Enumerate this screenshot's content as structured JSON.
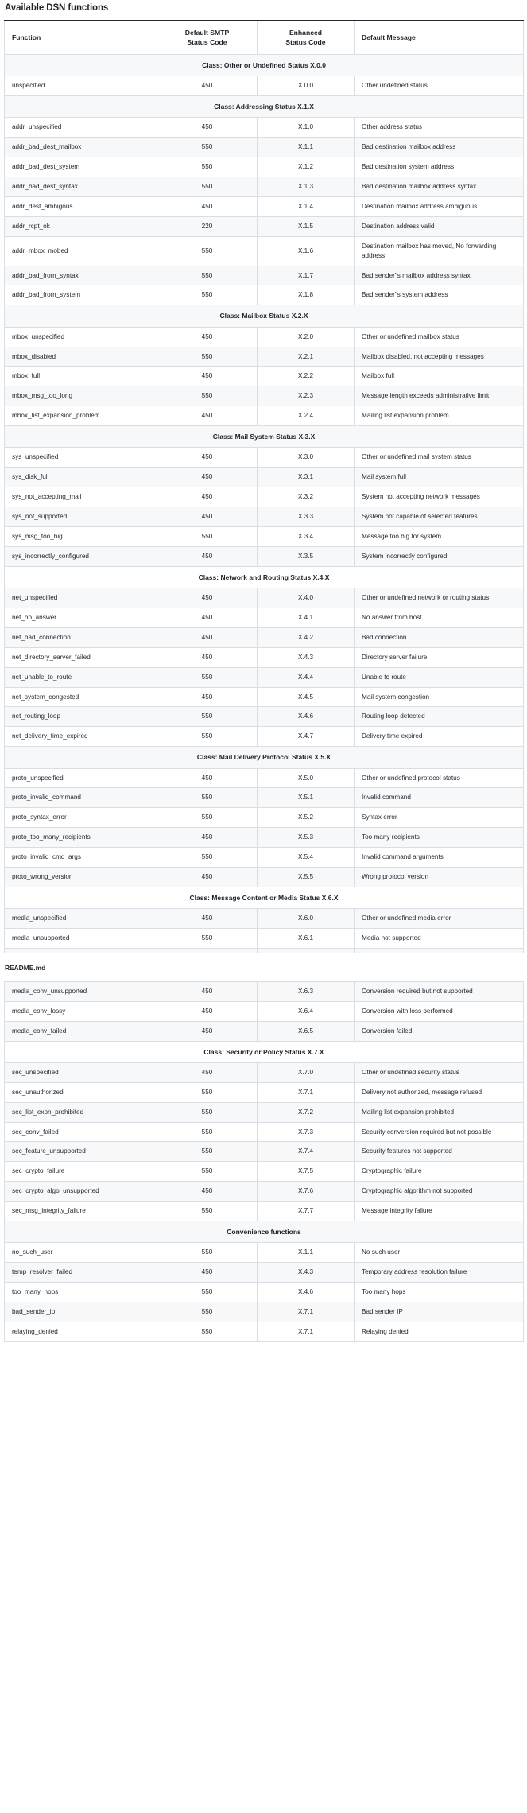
{
  "document": {
    "title": "Available DSN functions",
    "page_break_label": "README.md"
  },
  "table": {
    "columns": [
      {
        "label": "Function",
        "align": "left"
      },
      {
        "label": "Default SMTP Status Code",
        "line1": "Default SMTP",
        "line2": "Status Code",
        "align": "center"
      },
      {
        "label": "Enhanced Status Code",
        "line1": "Enhanced",
        "line2": "Status Code",
        "align": "center"
      },
      {
        "label": "Default Message",
        "align": "left"
      }
    ],
    "sections": [
      {
        "class_header": "Class: Other or Undefined Status X.0.0",
        "rows": [
          {
            "function": "unspecified",
            "smtp": "450",
            "enhanced": "X.0.0",
            "message": "Other undefined status"
          }
        ]
      },
      {
        "class_header": "Class: Addressing Status X.1.X",
        "rows": [
          {
            "function": "addr_unspecified",
            "smtp": "450",
            "enhanced": "X.1.0",
            "message": "Other address status"
          },
          {
            "function": "addr_bad_dest_mailbox",
            "smtp": "550",
            "enhanced": "X.1.1",
            "message": "Bad destination mailbox address"
          },
          {
            "function": "addr_bad_dest_system",
            "smtp": "550",
            "enhanced": "X.1.2",
            "message": "Bad destination system address"
          },
          {
            "function": "addr_bad_dest_syntax",
            "smtp": "550",
            "enhanced": "X.1.3",
            "message": "Bad destination mailbox address syntax"
          },
          {
            "function": "addr_dest_ambigous",
            "smtp": "450",
            "enhanced": "X.1.4",
            "message": "Destination mailbox address ambiguous"
          },
          {
            "function": "addr_rcpt_ok",
            "smtp": "220",
            "enhanced": "X.1.5",
            "message": "Destination address valid"
          },
          {
            "function": "addr_mbox_mobed",
            "smtp": "550",
            "enhanced": "X.1.6",
            "message": "Destination mailbox has moved, No forwarding address"
          },
          {
            "function": "addr_bad_from_syntax",
            "smtp": "550",
            "enhanced": "X.1.7",
            "message": "Bad sender\"s mailbox address syntax"
          },
          {
            "function": "addr_bad_from_system",
            "smtp": "550",
            "enhanced": "X.1.8",
            "message": "Bad sender\"s system address"
          }
        ]
      },
      {
        "class_header": "Class: Mailbox Status X.2.X",
        "rows": [
          {
            "function": "mbox_unspecified",
            "smtp": "450",
            "enhanced": "X.2.0",
            "message": "Other or undefined mailbox status"
          },
          {
            "function": "mbox_disabled",
            "smtp": "550",
            "enhanced": "X.2.1",
            "message": "Mailbox disabled, not accepting messages"
          },
          {
            "function": "mbox_full",
            "smtp": "450",
            "enhanced": "X.2.2",
            "message": "Mailbox full"
          },
          {
            "function": "mbox_msg_too_long",
            "smtp": "550",
            "enhanced": "X.2.3",
            "message": "Message length exceeds administrative limit"
          },
          {
            "function": "mbox_list_expansion_problem",
            "smtp": "450",
            "enhanced": "X.2.4",
            "message": "Mailing list expansion problem"
          }
        ]
      },
      {
        "class_header": "Class: Mail System Status X.3.X",
        "rows": [
          {
            "function": "sys_unspecified",
            "smtp": "450",
            "enhanced": "X.3.0",
            "message": "Other or undefined mail system status"
          },
          {
            "function": "sys_disk_full",
            "smtp": "450",
            "enhanced": "X.3.1",
            "message": "Mail system full"
          },
          {
            "function": "sys_not_accepting_mail",
            "smtp": "450",
            "enhanced": "X.3.2",
            "message": "System not accepting network messages"
          },
          {
            "function": "sys_not_supported",
            "smtp": "450",
            "enhanced": "X.3.3",
            "message": "System not capable of selected features"
          },
          {
            "function": "sys_msg_too_big",
            "smtp": "550",
            "enhanced": "X.3.4",
            "message": "Message too big for system"
          },
          {
            "function": "sys_incorrectly_configured",
            "smtp": "450",
            "enhanced": "X.3.5",
            "message": "System incorrectly configured"
          }
        ]
      },
      {
        "class_header": "Class: Network and Routing Status X.4.X",
        "rows": [
          {
            "function": "net_unspecified",
            "smtp": "450",
            "enhanced": "X.4.0",
            "message": "Other or undefined network or routing status"
          },
          {
            "function": "net_no_answer",
            "smtp": "450",
            "enhanced": "X.4.1",
            "message": "No answer from host"
          },
          {
            "function": "net_bad_connection",
            "smtp": "450",
            "enhanced": "X.4.2",
            "message": "Bad connection"
          },
          {
            "function": "net_directory_server_failed",
            "smtp": "450",
            "enhanced": "X.4.3",
            "message": "Directory server failure"
          },
          {
            "function": "net_unable_to_route",
            "smtp": "550",
            "enhanced": "X.4.4",
            "message": "Unable to route"
          },
          {
            "function": "net_system_congested",
            "smtp": "450",
            "enhanced": "X.4.5",
            "message": "Mail system congestion"
          },
          {
            "function": "net_routing_loop",
            "smtp": "550",
            "enhanced": "X.4.6",
            "message": "Routing loop detected"
          },
          {
            "function": "net_delivery_time_expired",
            "smtp": "550",
            "enhanced": "X.4.7",
            "message": "Delivery time expired"
          }
        ]
      },
      {
        "class_header": "Class: Mail Delivery Protocol Status X.5.X",
        "rows": [
          {
            "function": "proto_unspecified",
            "smtp": "450",
            "enhanced": "X.5.0",
            "message": "Other or undefined protocol status"
          },
          {
            "function": "proto_invalid_command",
            "smtp": "550",
            "enhanced": "X.5.1",
            "message": "Invalid command"
          },
          {
            "function": "proto_syntax_error",
            "smtp": "550",
            "enhanced": "X.5.2",
            "message": "Syntax error"
          },
          {
            "function": "proto_too_many_recipients",
            "smtp": "450",
            "enhanced": "X.5.3",
            "message": "Too many recipients"
          },
          {
            "function": "proto_invalid_cmd_args",
            "smtp": "550",
            "enhanced": "X.5.4",
            "message": "Invalid command arguments"
          },
          {
            "function": "proto_wrong_version",
            "smtp": "450",
            "enhanced": "X.5.5",
            "message": "Wrong protocol version"
          }
        ]
      },
      {
        "class_header": "Class: Message Content or Media Status X.6.X",
        "rows": [
          {
            "function": "media_unspecified",
            "smtp": "450",
            "enhanced": "X.6.0",
            "message": "Other or undefined media error"
          },
          {
            "function": "media_unsupported",
            "smtp": "550",
            "enhanced": "X.6.1",
            "message": "Media not supported"
          }
        ]
      }
    ],
    "sections_after_break": [
      {
        "class_header": null,
        "rows": [
          {
            "function": "media_conv_unsupported",
            "smtp": "450",
            "enhanced": "X.6.3",
            "message": "Conversion required but not supported"
          },
          {
            "function": "media_conv_lossy",
            "smtp": "450",
            "enhanced": "X.6.4",
            "message": "Conversion with loss performed"
          },
          {
            "function": "media_conv_failed",
            "smtp": "450",
            "enhanced": "X.6.5",
            "message": "Conversion failed"
          }
        ]
      },
      {
        "class_header": "Class: Security or Policy Status X.7.X",
        "rows": [
          {
            "function": "sec_unspecified",
            "smtp": "450",
            "enhanced": "X.7.0",
            "message": "Other or undefined security status"
          },
          {
            "function": "sec_unauthorized",
            "smtp": "550",
            "enhanced": "X.7.1",
            "message": "Delivery not authorized, message refused"
          },
          {
            "function": "sec_list_expn_prohibited",
            "smtp": "550",
            "enhanced": "X.7.2",
            "message": "Mailing list expansion prohibited"
          },
          {
            "function": "sec_conv_failed",
            "smtp": "550",
            "enhanced": "X.7.3",
            "message": "Security conversion required but not possible"
          },
          {
            "function": "sec_feature_unsupported",
            "smtp": "550",
            "enhanced": "X.7.4",
            "message": "Security features not supported"
          },
          {
            "function": "sec_crypto_failure",
            "smtp": "550",
            "enhanced": "X.7.5",
            "message": "Cryptographic failure"
          },
          {
            "function": "sec_crypto_algo_unsupported",
            "smtp": "450",
            "enhanced": "X.7.6",
            "message": "Cryptographic algorithm not supported"
          },
          {
            "function": "sec_msg_integrity_failure",
            "smtp": "550",
            "enhanced": "X.7.7",
            "message": "Message integrity failure"
          }
        ]
      },
      {
        "class_header": "Convenience functions",
        "rows": [
          {
            "function": "no_such_user",
            "smtp": "550",
            "enhanced": "X.1.1",
            "message": "No such user"
          },
          {
            "function": "temp_resolver_failed",
            "smtp": "450",
            "enhanced": "X.4.3",
            "message": "Temporary address resolution failure"
          },
          {
            "function": "too_many_hops",
            "smtp": "550",
            "enhanced": "X.4.6",
            "message": "Too many hops"
          },
          {
            "function": "bad_sender_ip",
            "smtp": "550",
            "enhanced": "X.7.1",
            "message": "Bad sender IP"
          },
          {
            "function": "relaying_denied",
            "smtp": "550",
            "enhanced": "X.7.1",
            "message": "Relaying denied"
          }
        ]
      }
    ]
  },
  "colors": {
    "page_background": "#ffffff",
    "text": "#24292f",
    "heading_text": "#1f2328",
    "border": "#d8dee4",
    "top_border": "#24292f",
    "zebra_shade": "#f6f8fa"
  }
}
